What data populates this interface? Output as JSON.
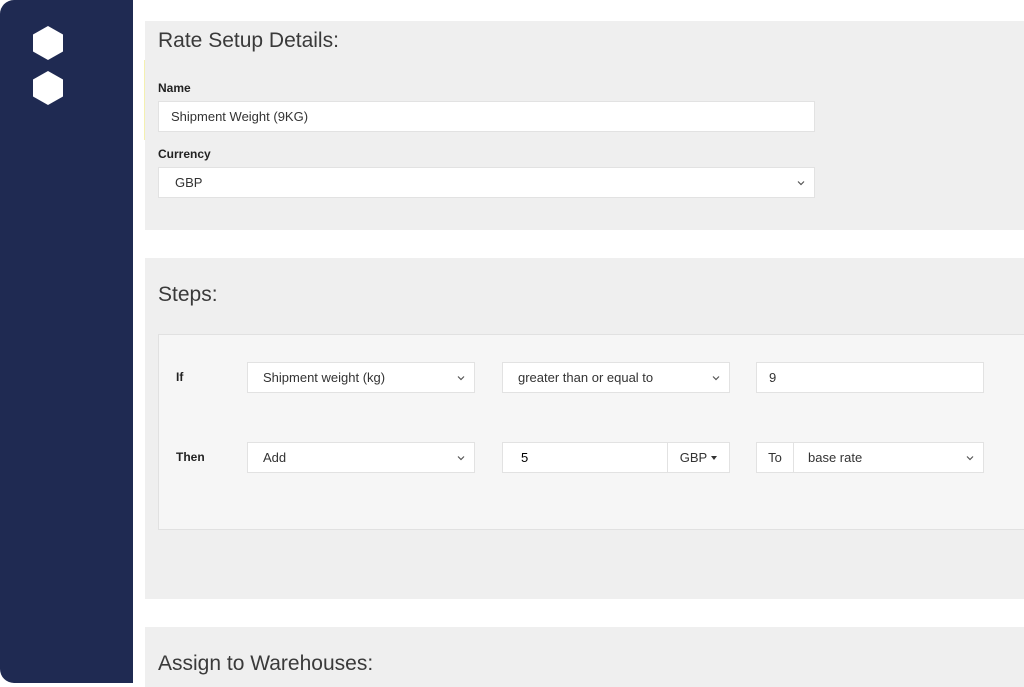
{
  "rate_setup": {
    "title": "Rate Setup Details:",
    "name_label": "Name",
    "name_value": "Shipment Weight (9KG)",
    "currency_label": "Currency",
    "currency_value": "GBP"
  },
  "steps": {
    "title": "Steps:",
    "if_label": "If",
    "if_field": "Shipment weight (kg)",
    "if_operator": "greater than or equal to",
    "if_value": "9",
    "then_label": "Then",
    "then_action": "Add",
    "then_amount": "5",
    "then_currency": "GBP",
    "then_to_label": "To",
    "then_target": "base rate"
  },
  "warehouses": {
    "title": "Assign to Warehouses:"
  },
  "colors": {
    "sidebar": "#1f2a52",
    "panel": "#efefef"
  },
  "icons": {
    "logo": "hexagon-logo-icon",
    "select": "chevron-down-icon"
  }
}
